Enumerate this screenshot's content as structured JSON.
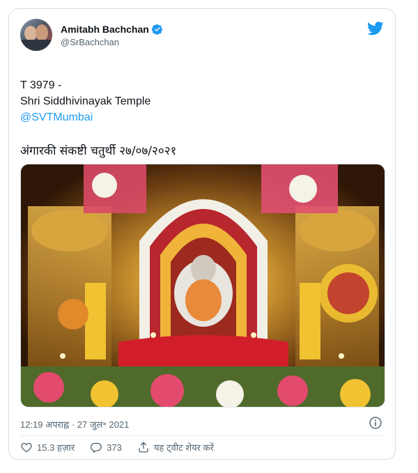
{
  "author": {
    "name": "Amitabh Bachchan",
    "handle": "@SrBachchan"
  },
  "tweet": {
    "line1": "T 3979 -",
    "line2": "Shri Siddhivinayak Temple",
    "mention": "@SVTMumbai",
    "hindi": "अंगारकी संकष्टी चतुर्थी २७/०७/२०२१"
  },
  "meta": {
    "timestamp": "12:19 अपराह्न · 27 जुल॰ 2021"
  },
  "actions": {
    "likes": "15.3 हज़ार",
    "replies": "373",
    "share": "यह ट्वीट शेयर करें"
  },
  "colors": {
    "accent": "#1d9bf0",
    "secondary_text": "#536471"
  },
  "icons": [
    "verified-badge-icon",
    "twitter-bird-icon",
    "info-icon",
    "heart-icon",
    "reply-icon",
    "share-icon"
  ]
}
